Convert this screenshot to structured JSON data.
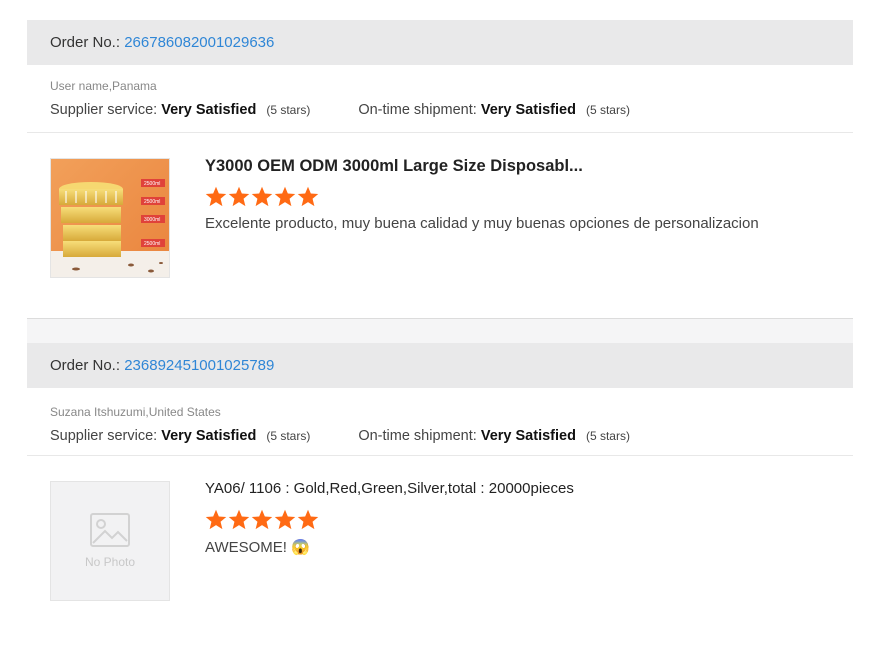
{
  "reviews": [
    {
      "order_label": "Order No.:",
      "order_number": "266786082001029636",
      "buyer": "User name,Panama",
      "supplier_label": "Supplier service:",
      "supplier_value": "Very Satisfied",
      "supplier_stars_text": "(5 stars)",
      "shipment_label": "On-time shipment:",
      "shipment_value": "Very Satisfied",
      "shipment_stars_text": "(5 stars)",
      "product_title": "Y3000 OEM ODM 3000ml Large Size Disposabl...",
      "rating": 5,
      "comment": "Excelente producto, muy buena calidad y muy buenas opciones de personalizacion",
      "thumb_labels": [
        "2500ml",
        "2500ml",
        "3000ml",
        "2500ml"
      ]
    },
    {
      "order_label": "Order No.:",
      "order_number": "236892451001025789",
      "buyer": "Suzana Itshuzumi,United States",
      "supplier_label": "Supplier service:",
      "supplier_value": "Very Satisfied",
      "supplier_stars_text": "(5 stars)",
      "shipment_label": "On-time shipment:",
      "shipment_value": "Very Satisfied",
      "shipment_stars_text": "(5 stars)",
      "product_title": "YA06/ 1106 : Gold,Red,Green,Silver,total : 20000pieces",
      "rating": 5,
      "comment": "AWESOME! 😱",
      "no_photo_text": "No Photo"
    }
  ],
  "colors": {
    "star": "#ff6a14",
    "link": "#2f86d6",
    "order_bar": "#e9e9ea"
  },
  "icons": {
    "star": "star-icon",
    "placeholder": "image-placeholder-icon"
  }
}
